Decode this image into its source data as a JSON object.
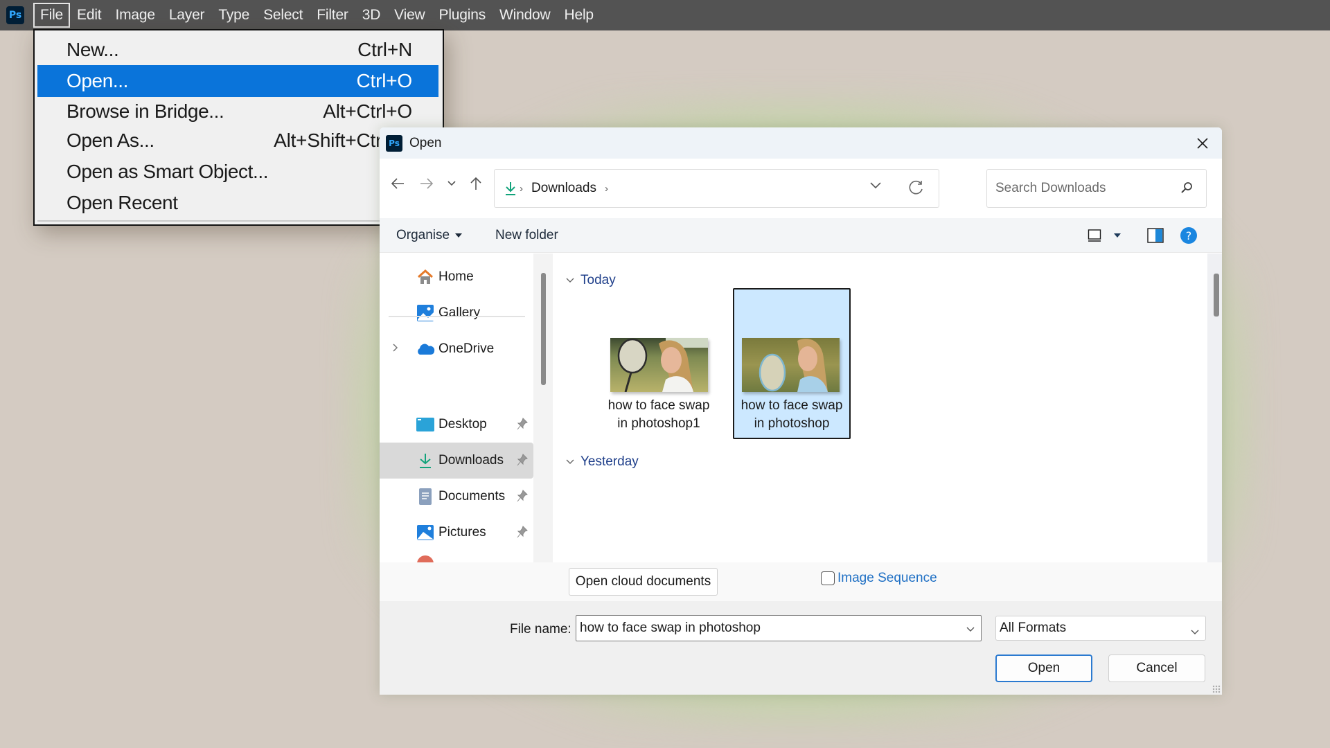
{
  "app": {
    "name": "Photoshop",
    "logo_text": "Ps"
  },
  "menubar": {
    "items": [
      {
        "label": "File",
        "active": true
      },
      {
        "label": "Edit"
      },
      {
        "label": "Image"
      },
      {
        "label": "Layer"
      },
      {
        "label": "Type"
      },
      {
        "label": "Select"
      },
      {
        "label": "Filter"
      },
      {
        "label": "3D"
      },
      {
        "label": "View"
      },
      {
        "label": "Plugins"
      },
      {
        "label": "Window"
      },
      {
        "label": "Help"
      }
    ]
  },
  "file_menu": {
    "items": [
      {
        "label": "New...",
        "shortcut": "Ctrl+N"
      },
      {
        "label": "Open...",
        "shortcut": "Ctrl+O",
        "highlighted": true
      },
      {
        "label": "Browse in Bridge...",
        "shortcut": "Alt+Ctrl+O"
      },
      {
        "label": "Open As...",
        "shortcut": "Alt+Shift+Ctrl+O"
      },
      {
        "label": "Open as Smart Object...",
        "shortcut": ""
      },
      {
        "label": "Open Recent",
        "shortcut": ""
      }
    ],
    "highlight_color": "#0a74da"
  },
  "dialog": {
    "title": "Open",
    "icon_text": "Ps",
    "nav": {
      "back_icon": "arrow-left-icon",
      "forward_icon": "arrow-right-icon",
      "recent_icon": "chevron-down-icon",
      "up_icon": "arrow-up-icon"
    },
    "address": {
      "location_icon": "downloads-icon",
      "crumbs": [
        "Downloads"
      ]
    },
    "search": {
      "placeholder": "Search Downloads",
      "value": ""
    },
    "command_bar": {
      "organise": "Organise",
      "new_folder": "New folder"
    },
    "nav_pane": {
      "items": [
        {
          "label": "Home",
          "icon": "home-icon"
        },
        {
          "label": "Gallery",
          "icon": "gallery-icon"
        },
        {
          "label": "OneDrive",
          "icon": "onedrive-icon",
          "expandable": true
        },
        {
          "label": "Desktop",
          "icon": "desktop-icon",
          "pinned": true
        },
        {
          "label": "Downloads",
          "icon": "downloads-icon",
          "pinned": true,
          "selected": true
        },
        {
          "label": "Documents",
          "icon": "documents-icon",
          "pinned": true
        },
        {
          "label": "Pictures",
          "icon": "pictures-icon",
          "pinned": true
        }
      ]
    },
    "groups": [
      {
        "label": "Today",
        "files": [
          {
            "name_line1": "how to face swap",
            "name_line2": "in photoshop1",
            "selected": false
          },
          {
            "name_line1": "how to face swap",
            "name_line2": "in photoshop",
            "selected": true
          }
        ]
      },
      {
        "label": "Yesterday",
        "files": []
      }
    ],
    "open_cloud_documents": "Open cloud documents",
    "image_sequence": {
      "label": "Image Sequence",
      "checked": false
    },
    "file_name": {
      "label": "File name:",
      "value": "how to face swap in photoshop"
    },
    "file_type": {
      "value": "All Formats"
    },
    "buttons": {
      "open": "Open",
      "cancel": "Cancel"
    }
  },
  "colors": {
    "menubar_bg": "#535353",
    "background": "#d4cbc2",
    "selection_bg": "#cce8ff",
    "link_blue": "#1e6fc4",
    "group_header": "#1f3f8a"
  }
}
